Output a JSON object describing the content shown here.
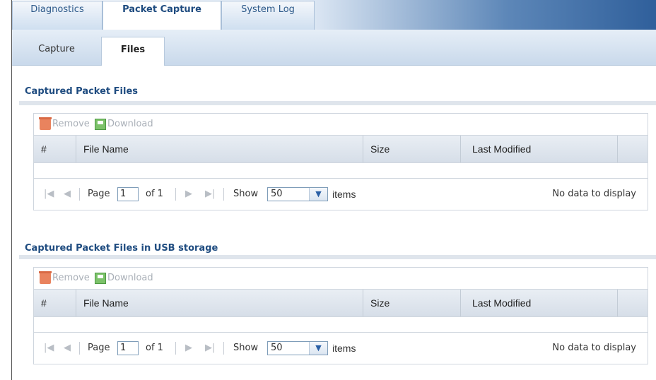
{
  "main_tabs": [
    "Diagnostics",
    "Packet Capture",
    "System Log"
  ],
  "sub_tabs": [
    "Capture",
    "Files"
  ],
  "sections": [
    {
      "title": "Captured Packet Files",
      "toolbar": {
        "remove": "Remove",
        "download": "Download"
      },
      "columns": [
        "#",
        "File Name",
        "Size",
        "Last Modified"
      ],
      "pager": {
        "page_label": "Page",
        "page_value": "1",
        "of_label": "of 1",
        "show_label": "Show",
        "show_value": "50",
        "items_label": "items",
        "empty_text": "No data to display"
      }
    },
    {
      "title": "Captured Packet Files in USB storage",
      "toolbar": {
        "remove": "Remove",
        "download": "Download"
      },
      "columns": [
        "#",
        "File Name",
        "Size",
        "Last Modified"
      ],
      "pager": {
        "page_label": "Page",
        "page_value": "1",
        "of_label": "of 1",
        "show_label": "Show",
        "show_value": "50",
        "items_label": "items",
        "empty_text": "No data to display"
      }
    }
  ]
}
